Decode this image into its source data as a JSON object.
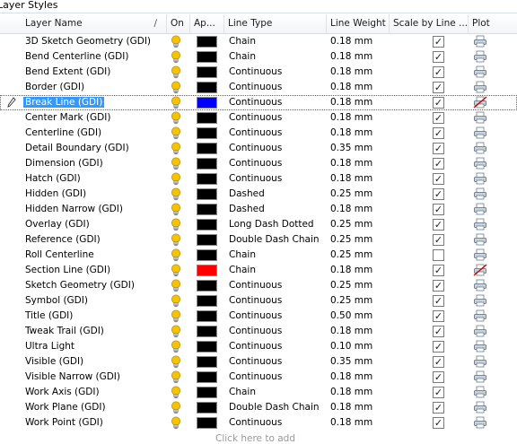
{
  "panel": {
    "title": "Layer Styles"
  },
  "columns": {
    "name": "Layer Name",
    "on": "On",
    "appearance": "Ap...",
    "line_type": "Line Type",
    "line_weight": "Line Weight",
    "scale": "Scale by Line ...",
    "plot": "Plot"
  },
  "colors": {
    "selection": "#3399ff",
    "bulb": "#f5c400",
    "plot_disabled_mark": "#d00000"
  },
  "icons": {
    "on": "lightbulb-icon",
    "plot": "printer-icon",
    "edit": "pencil-icon",
    "sort": "sort-indicator"
  },
  "rows": [
    {
      "name": "3D Sketch Geometry (GDI)",
      "color": "#000000",
      "line_type": "Chain",
      "weight": "0.18 mm",
      "scale": true,
      "plot": true
    },
    {
      "name": "Bend Centerline (GDI)",
      "color": "#000000",
      "line_type": "Chain",
      "weight": "0.18 mm",
      "scale": true,
      "plot": true
    },
    {
      "name": "Bend Extent (GDI)",
      "color": "#000000",
      "line_type": "Continuous",
      "weight": "0.18 mm",
      "scale": true,
      "plot": true
    },
    {
      "name": "Border (GDI)",
      "color": "#000000",
      "line_type": "Continuous",
      "weight": "0.18 mm",
      "scale": true,
      "plot": true
    },
    {
      "name": "Break Line (GDI)",
      "color": "#0000ff",
      "line_type": "Continuous",
      "weight": "0.18 mm",
      "scale": true,
      "plot": false,
      "selected": true
    },
    {
      "name": "Center Mark (GDI)",
      "color": "#000000",
      "line_type": "Continuous",
      "weight": "0.18 mm",
      "scale": true,
      "plot": true
    },
    {
      "name": "Centerline (GDI)",
      "color": "#000000",
      "line_type": "Continuous",
      "weight": "0.18 mm",
      "scale": true,
      "plot": true
    },
    {
      "name": "Detail Boundary (GDI)",
      "color": "#000000",
      "line_type": "Continuous",
      "weight": "0.35 mm",
      "scale": true,
      "plot": true
    },
    {
      "name": "Dimension (GDI)",
      "color": "#000000",
      "line_type": "Continuous",
      "weight": "0.18 mm",
      "scale": true,
      "plot": true
    },
    {
      "name": "Hatch (GDI)",
      "color": "#000000",
      "line_type": "Continuous",
      "weight": "0.18 mm",
      "scale": true,
      "plot": true
    },
    {
      "name": "Hidden (GDI)",
      "color": "#000000",
      "line_type": "Dashed",
      "weight": "0.25 mm",
      "scale": true,
      "plot": true
    },
    {
      "name": "Hidden Narrow (GDI)",
      "color": "#000000",
      "line_type": "Dashed",
      "weight": "0.18 mm",
      "scale": true,
      "plot": true
    },
    {
      "name": "Overlay (GDI)",
      "color": "#000000",
      "line_type": "Long Dash Dotted",
      "weight": "0.25 mm",
      "scale": true,
      "plot": true
    },
    {
      "name": "Reference (GDI)",
      "color": "#000000",
      "line_type": "Double Dash Chain",
      "weight": "0.25 mm",
      "scale": true,
      "plot": true
    },
    {
      "name": "Roll Centerline",
      "color": "#000000",
      "line_type": "Chain",
      "weight": "0.25 mm",
      "scale": false,
      "plot": true
    },
    {
      "name": "Section Line (GDI)",
      "color": "#ff0000",
      "line_type": "Chain",
      "weight": "0.18 mm",
      "scale": true,
      "plot": false
    },
    {
      "name": "Sketch Geometry (GDI)",
      "color": "#000000",
      "line_type": "Continuous",
      "weight": "0.25 mm",
      "scale": true,
      "plot": true
    },
    {
      "name": "Symbol (GDI)",
      "color": "#000000",
      "line_type": "Continuous",
      "weight": "0.25 mm",
      "scale": true,
      "plot": true
    },
    {
      "name": "Title (GDI)",
      "color": "#000000",
      "line_type": "Continuous",
      "weight": "0.50 mm",
      "scale": true,
      "plot": true
    },
    {
      "name": "Tweak Trail (GDI)",
      "color": "#000000",
      "line_type": "Continuous",
      "weight": "0.18 mm",
      "scale": true,
      "plot": true
    },
    {
      "name": "Ultra Light",
      "color": "#000000",
      "line_type": "Continuous",
      "weight": "0.10 mm",
      "scale": true,
      "plot": true
    },
    {
      "name": "Visible (GDI)",
      "color": "#000000",
      "line_type": "Continuous",
      "weight": "0.35 mm",
      "scale": true,
      "plot": true
    },
    {
      "name": "Visible Narrow (GDI)",
      "color": "#000000",
      "line_type": "Continuous",
      "weight": "0.18 mm",
      "scale": true,
      "plot": true
    },
    {
      "name": "Work Axis (GDI)",
      "color": "#000000",
      "line_type": "Chain",
      "weight": "0.18 mm",
      "scale": true,
      "plot": true
    },
    {
      "name": "Work Plane (GDI)",
      "color": "#000000",
      "line_type": "Double Dash Chain",
      "weight": "0.18 mm",
      "scale": true,
      "plot": true
    },
    {
      "name": "Work Point (GDI)",
      "color": "#000000",
      "line_type": "Continuous",
      "weight": "0.18 mm",
      "scale": true,
      "plot": true
    }
  ],
  "add_row_text": "Click here to add"
}
